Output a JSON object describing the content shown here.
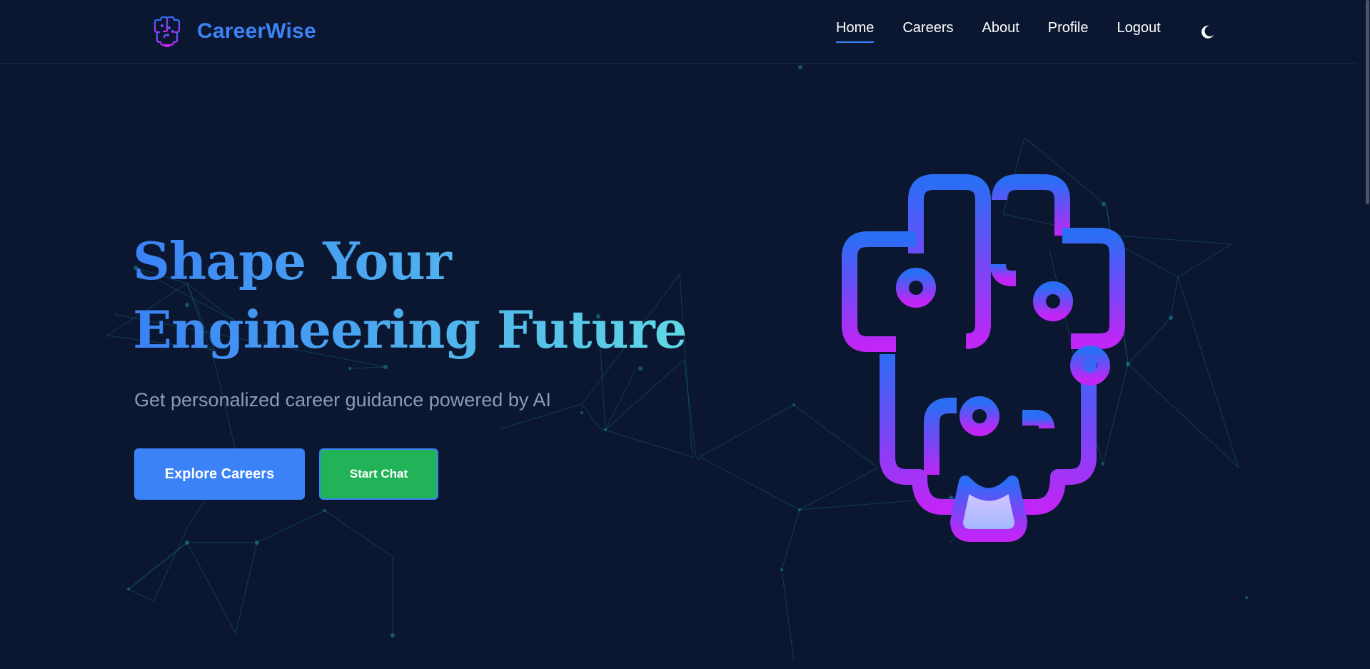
{
  "brand": {
    "name": "CareerWise",
    "logo_icon": "brain-circuit-icon",
    "color": "#3b82f6"
  },
  "nav": {
    "items": [
      {
        "label": "Home",
        "active": true
      },
      {
        "label": "Careers",
        "active": false
      },
      {
        "label": "About",
        "active": false
      },
      {
        "label": "Profile",
        "active": false
      },
      {
        "label": "Logout",
        "active": false
      }
    ],
    "theme_toggle_icon": "moon-icon"
  },
  "hero": {
    "title_line1": "Shape Your",
    "title_line2": "Engineering Future",
    "subtitle": "Get personalized career guidance powered by AI",
    "primary_button": "Explore Careers",
    "secondary_button": "Start Chat",
    "illustration_icon": "brain-circuit-icon"
  },
  "colors": {
    "background": "#0b1730",
    "accent_blue": "#3b82f6",
    "accent_green": "#22b359",
    "gradient_start": "#3b82f6",
    "gradient_end": "#5fd9e6",
    "brain_gradient_top": "#2b6ef5",
    "brain_gradient_bottom": "#c026f5",
    "network_line": "#0e7490"
  }
}
